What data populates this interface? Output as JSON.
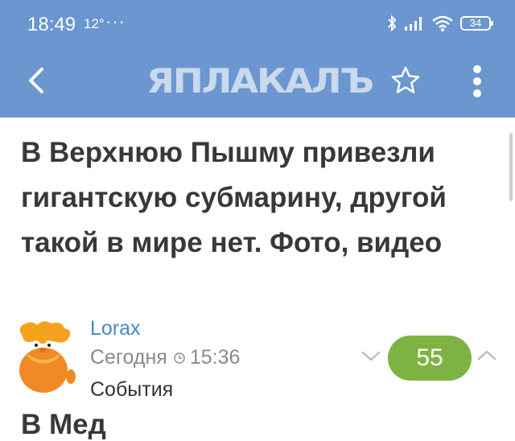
{
  "status_bar": {
    "time": "18:49",
    "temperature": "12°",
    "more": "···",
    "battery": "34"
  },
  "toolbar": {
    "logo_text": "ЯПЛАКАЛЪ"
  },
  "article": {
    "title": "В Верхнюю Пышму привезли гигантскую субмарину, другой такой в мире нет. Фото, видео",
    "author": "Lorax",
    "date": "Сегодня",
    "time": "15:36",
    "category": "События",
    "rating": "55",
    "next_text_partial": "В Мед"
  },
  "colors": {
    "header": "#6b96cf",
    "rating_badge": "#7cb342",
    "author_link": "#4a86c8"
  }
}
